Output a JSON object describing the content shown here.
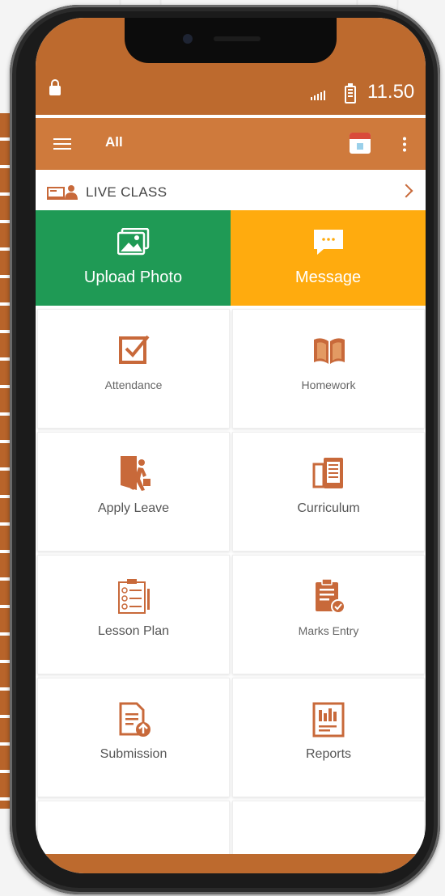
{
  "status_bar": {
    "time": "11.50"
  },
  "toolbar": {
    "title": "All"
  },
  "live_class": {
    "label": "LIVE CLASS"
  },
  "featured": [
    {
      "label": "Upload Photo",
      "icon": "image-icon",
      "color": "#1f9a55"
    },
    {
      "label": "Message",
      "icon": "chat-icon",
      "color": "#ffab0e"
    }
  ],
  "tiles": [
    {
      "label": "Attendance",
      "icon": "checkbox-icon"
    },
    {
      "label": "Homework",
      "icon": "book-icon"
    },
    {
      "label": "Apply Leave",
      "icon": "exit-door-icon"
    },
    {
      "label": "Curriculum",
      "icon": "ebook-icon"
    },
    {
      "label": "Lesson Plan",
      "icon": "checklist-icon"
    },
    {
      "label": "Marks Entry",
      "icon": "clipboard-check-icon"
    },
    {
      "label": "Submission",
      "icon": "document-upload-icon"
    },
    {
      "label": "Reports",
      "icon": "report-chart-icon"
    }
  ],
  "colors": {
    "primary": "#bd6a2e",
    "toolbar": "#cf7a3c",
    "accent": "#c8693a"
  }
}
